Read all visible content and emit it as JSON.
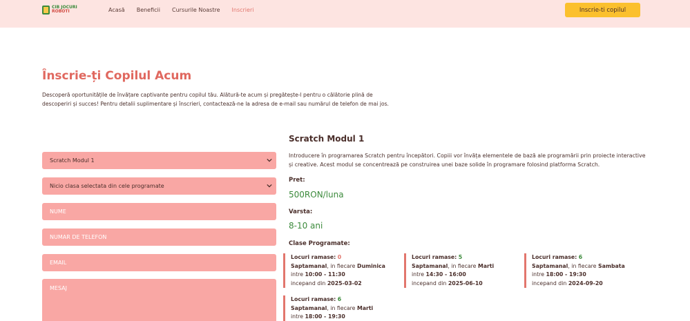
{
  "header": {
    "logo_line1": "CIB JOCURI",
    "logo_line2": "ROBOTI",
    "nav": [
      {
        "label": "Acasă",
        "active": false
      },
      {
        "label": "Beneficii",
        "active": false
      },
      {
        "label": "Cursurile Noastre",
        "active": false
      },
      {
        "label": "Inscrieri",
        "active": true
      }
    ],
    "cta_label": "Inscrie-ti copilul"
  },
  "hero": {
    "title": "Înscrie-ți Copilul Acum",
    "description": "Descoperă oportunitățile de învățare captivante pentru copilul tău. Alătură-te acum și pregătește-l pentru o călătorie plină de descoperiri și succes! Pentru detalii suplimentare și înscrieri, contactează-ne la adresa de e-mail sau numărul de telefon de mai jos."
  },
  "form": {
    "course_select": "Scratch Modul 1",
    "class_select": "Nicio clasa selectata din cele programate",
    "name_placeholder": "NUME",
    "phone_placeholder": "NUMAR DE TELEFON",
    "email_placeholder": "EMAIL",
    "message_placeholder": "MESAJ"
  },
  "course": {
    "title": "Scratch Modul 1",
    "description": "Introducere în programarea Scratch pentru începători. Copiii vor învăța elementele de bază ale programării prin proiecte interactive și creative. Acest modul se concentrează pe construirea unei baze solide în programare folosind platforma Scratch.",
    "price_label": "Pret:",
    "price_value": "500RON/luna",
    "age_label": "Varsta:",
    "age_value": "8-10 ani",
    "classes_label": "Clase Programate:",
    "slots": [
      {
        "spots_label": "Locuri ramase:",
        "spots": "0",
        "freq": "Saptamanal",
        "day_prefix": ", in fiecare",
        "day": "Duminica",
        "between": "intre",
        "time": "10:00 - 11:30",
        "since": "incepand din",
        "date": "2025-03-02"
      },
      {
        "spots_label": "Locuri ramase:",
        "spots": "5",
        "freq": "Saptamanal",
        "day_prefix": ", in fiecare",
        "day": "Marti",
        "between": "intre",
        "time": "14:30 - 16:00",
        "since": "incepand din",
        "date": "2025-06-10"
      },
      {
        "spots_label": "Locuri ramase:",
        "spots": "6",
        "freq": "Saptamanal",
        "day_prefix": ", in fiecare",
        "day": "Sambata",
        "between": "intre",
        "time": "18:00 - 19:30",
        "since": "incepand din",
        "date": "2024-09-20"
      },
      {
        "spots_label": "Locuri ramase:",
        "spots": "6",
        "freq": "Saptamanal",
        "day_prefix": ", in fiecare",
        "day": "Marti",
        "between": "intre",
        "time": "18:00 - 19:30"
      }
    ]
  }
}
